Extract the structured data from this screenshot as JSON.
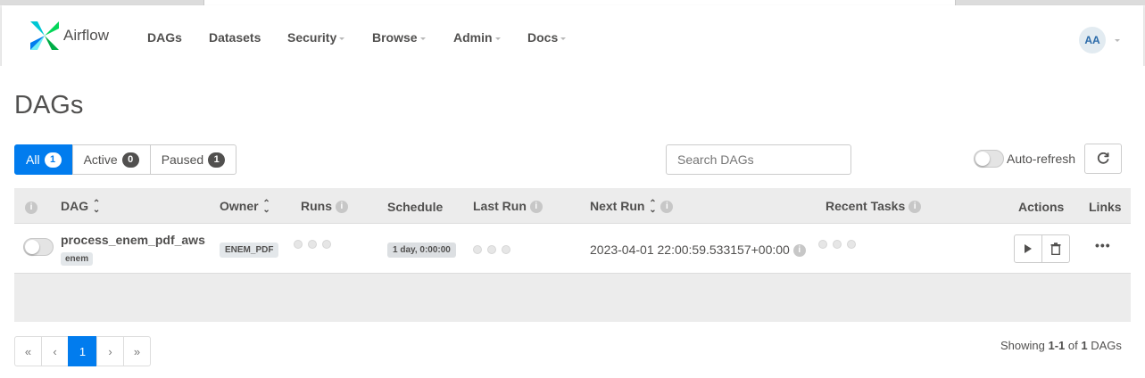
{
  "app": {
    "name": "Airflow"
  },
  "nav": {
    "items": [
      {
        "label": "DAGs",
        "dropdown": false
      },
      {
        "label": "Datasets",
        "dropdown": false
      },
      {
        "label": "Security",
        "dropdown": true
      },
      {
        "label": "Browse",
        "dropdown": true
      },
      {
        "label": "Admin",
        "dropdown": true
      },
      {
        "label": "Docs",
        "dropdown": true
      }
    ],
    "user_initials": "AA"
  },
  "page": {
    "title": "DAGs"
  },
  "filters": {
    "all": {
      "label": "All",
      "count": "1",
      "active": true
    },
    "active": {
      "label": "Active",
      "count": "0"
    },
    "paused": {
      "label": "Paused",
      "count": "1"
    }
  },
  "search": {
    "placeholder": "Search DAGs"
  },
  "auto_refresh": {
    "label": "Auto-refresh",
    "enabled": false
  },
  "table": {
    "columns": {
      "dag": "DAG",
      "owner": "Owner",
      "runs": "Runs",
      "schedule": "Schedule",
      "last_run": "Last Run",
      "next_run": "Next Run",
      "recent_tasks": "Recent Tasks",
      "actions": "Actions",
      "links": "Links"
    },
    "rows": [
      {
        "dag_id": "process_enem_pdf_aws",
        "tag": "enem",
        "owner": "ENEM_PDF",
        "schedule": "1 day, 0:00:00",
        "next_run": "2023-04-01 22:00:59.533157+00:00",
        "paused": true,
        "links_label": "•••"
      }
    ]
  },
  "pagination": {
    "first": "«",
    "prev": "‹",
    "current": "1",
    "next": "›",
    "last": "»"
  },
  "showing": {
    "prefix": "Showing ",
    "range": "1-1",
    "of": " of ",
    "total": "1",
    "suffix": " DAGs"
  },
  "colors": {
    "primary": "#017cee",
    "text": "#51504f",
    "header_bg": "#ececec"
  }
}
